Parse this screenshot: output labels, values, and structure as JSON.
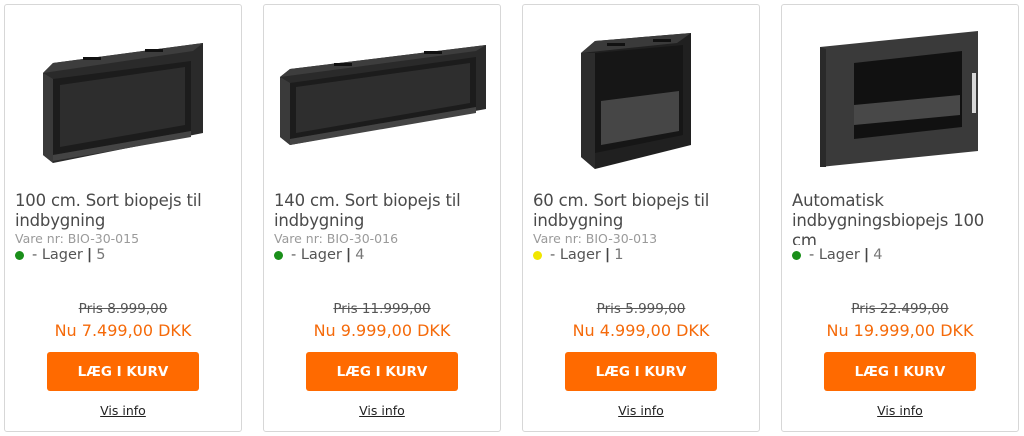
{
  "colors": {
    "accent": "#ff6a00",
    "price_now": "#f56a0a",
    "stock_green": "#1a8f1a",
    "stock_yellow": "#f1e600"
  },
  "products": [
    {
      "title": "100 cm. Sort biopejs til indbygning",
      "sku": "Vare nr: BIO-30-015",
      "stock_status_color": "green",
      "stock_label": "- Lager",
      "stock_qty": "5",
      "price_before": "Pris 8.999,00",
      "price_now": "Nu 7.499,00 DKK",
      "button_label": "LÆG I KURV",
      "info_link": "Vis info",
      "image_icon": "fireplace-wide-icon"
    },
    {
      "title": "140 cm. Sort biopejs til indbygning",
      "sku": "Vare nr: BIO-30-016",
      "stock_status_color": "green",
      "stock_label": "- Lager",
      "stock_qty": "4",
      "price_before": "Pris 11.999,00",
      "price_now": "Nu 9.999,00 DKK",
      "button_label": "LÆG I KURV",
      "info_link": "Vis info",
      "image_icon": "fireplace-extra-wide-icon"
    },
    {
      "title": "60 cm. Sort biopejs til indbygning",
      "sku": "Vare nr: BIO-30-013",
      "stock_status_color": "yellow",
      "stock_label": "- Lager",
      "stock_qty": "1",
      "price_before": "Pris 5.999,00",
      "price_now": "Nu 4.999,00 DKK",
      "button_label": "LÆG I KURV",
      "info_link": "Vis info",
      "image_icon": "fireplace-box-icon"
    },
    {
      "title": "Automatisk indbygningsbiopejs 100 cm",
      "sku": "",
      "stock_status_color": "green",
      "stock_label": "- Lager",
      "stock_qty": "4",
      "price_before": "Pris 22.499,00",
      "price_now": "Nu 19.999,00 DKK",
      "button_label": "LÆG I KURV",
      "info_link": "Vis info",
      "image_icon": "fireplace-framed-icon"
    }
  ]
}
